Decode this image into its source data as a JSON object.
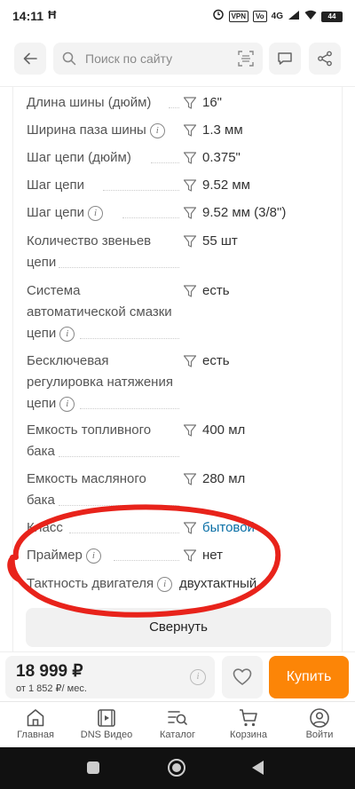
{
  "status_bar": {
    "time": "14:11",
    "left_icon": "Ħ",
    "vpn": "VPN",
    "volte": "Vo",
    "network": "4G",
    "battery": "44"
  },
  "header": {
    "search_placeholder": "Поиск по сайту"
  },
  "specs": [
    {
      "label": "Длина шины (дюйм)",
      "value": "16\"",
      "info": false
    },
    {
      "label": "Ширина паза шины",
      "value": "1.3 мм",
      "info": true
    },
    {
      "label": "Шаг цепи (дюйм)",
      "value": "0.375\"",
      "info": false
    },
    {
      "label": "Шаг цепи",
      "value": "9.52 мм",
      "info": false
    },
    {
      "label": "Шаг цепи",
      "value": "9.52 мм (3/8\")",
      "info": true
    },
    {
      "label": "Количество звеньев цепи",
      "value": "55 шт",
      "info": false
    },
    {
      "label": "Система автоматической смазки цепи",
      "value": "есть",
      "info": true
    },
    {
      "label": "Бесключевая регулировка натяжения цепи",
      "value": "есть",
      "info": true
    },
    {
      "label": "Емкость топливного бака",
      "value": "400 мл",
      "info": false
    },
    {
      "label": "Емкость масляного бака",
      "value": "280 мл",
      "info": false
    },
    {
      "label": "Класс",
      "value": "бытовой",
      "info": false
    },
    {
      "label": "Праймер",
      "value": "нет",
      "info": true
    },
    {
      "label": "Тактность двигателя",
      "value": "двухтактный",
      "info": true
    }
  ],
  "collapse_label": "Свернуть",
  "buy_bar": {
    "price": "18 999 ₽",
    "credit": "от 1 852 ₽/ мес.",
    "buy_label": "Купить",
    "accent_color": "#fc8507"
  },
  "bottom_nav": {
    "items": [
      {
        "label": "Главная",
        "icon": "home-icon"
      },
      {
        "label": "DNS Видео",
        "icon": "video-icon"
      },
      {
        "label": "Каталог",
        "icon": "catalog-icon"
      },
      {
        "label": "Корзина",
        "icon": "cart-icon"
      },
      {
        "label": "Войти",
        "icon": "user-icon"
      }
    ]
  },
  "annotation_color": "#e8231b"
}
